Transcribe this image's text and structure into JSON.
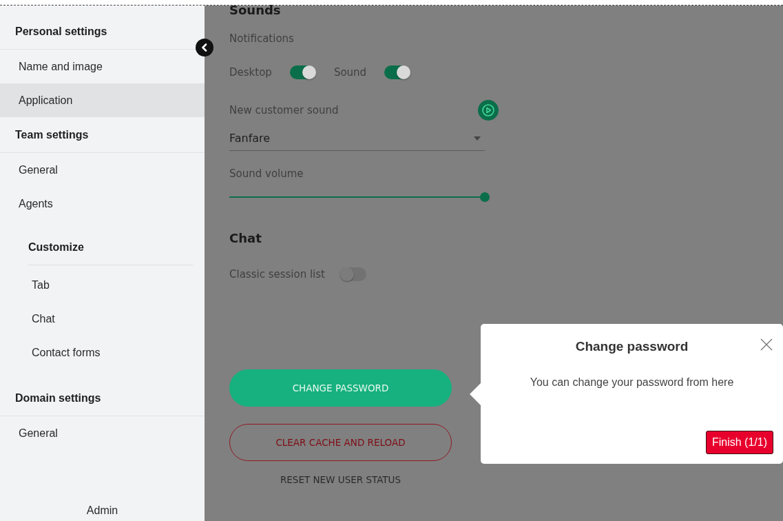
{
  "sidebar": {
    "sections": [
      {
        "title": "Personal settings",
        "items": [
          {
            "label": "Name and image",
            "selected": false
          },
          {
            "label": "Application",
            "selected": true
          }
        ]
      },
      {
        "title": "Team settings",
        "items": [
          {
            "label": "General",
            "selected": false
          },
          {
            "label": "Agents",
            "selected": false
          }
        ],
        "subsections": [
          {
            "title": "Customize",
            "items": [
              {
                "label": "Tab",
                "selected": false
              },
              {
                "label": "Chat",
                "selected": false
              },
              {
                "label": "Contact forms",
                "selected": false
              }
            ]
          }
        ]
      },
      {
        "title": "Domain settings",
        "items": [
          {
            "label": "General",
            "selected": false
          }
        ]
      }
    ],
    "footer": "Admin"
  },
  "main": {
    "heading": "Sounds",
    "notifications_label": "Notifications",
    "toggles": [
      {
        "label": "Desktop",
        "on": true
      },
      {
        "label": "Sound",
        "on": true
      }
    ],
    "sound_label": "New customer sound",
    "sound_select": {
      "value": "Fanfare"
    },
    "volume": {
      "label": "Sound volume",
      "level": 1
    },
    "chat_heading": "Chat",
    "chat_toggles": [
      {
        "label": "Classic session list",
        "on": false
      }
    ],
    "buttons": [
      {
        "label": "CHANGE PASSWORD",
        "kind": "primary"
      },
      {
        "label": "CLEAR CACHE AND RELOAD",
        "kind": "outline"
      },
      {
        "label": "RESET NEW USER STATUS",
        "kind": "text"
      }
    ]
  },
  "tour_popover": {
    "title": "Change password",
    "text": "You can change your password from here",
    "button": "Finish (1/1)"
  }
}
